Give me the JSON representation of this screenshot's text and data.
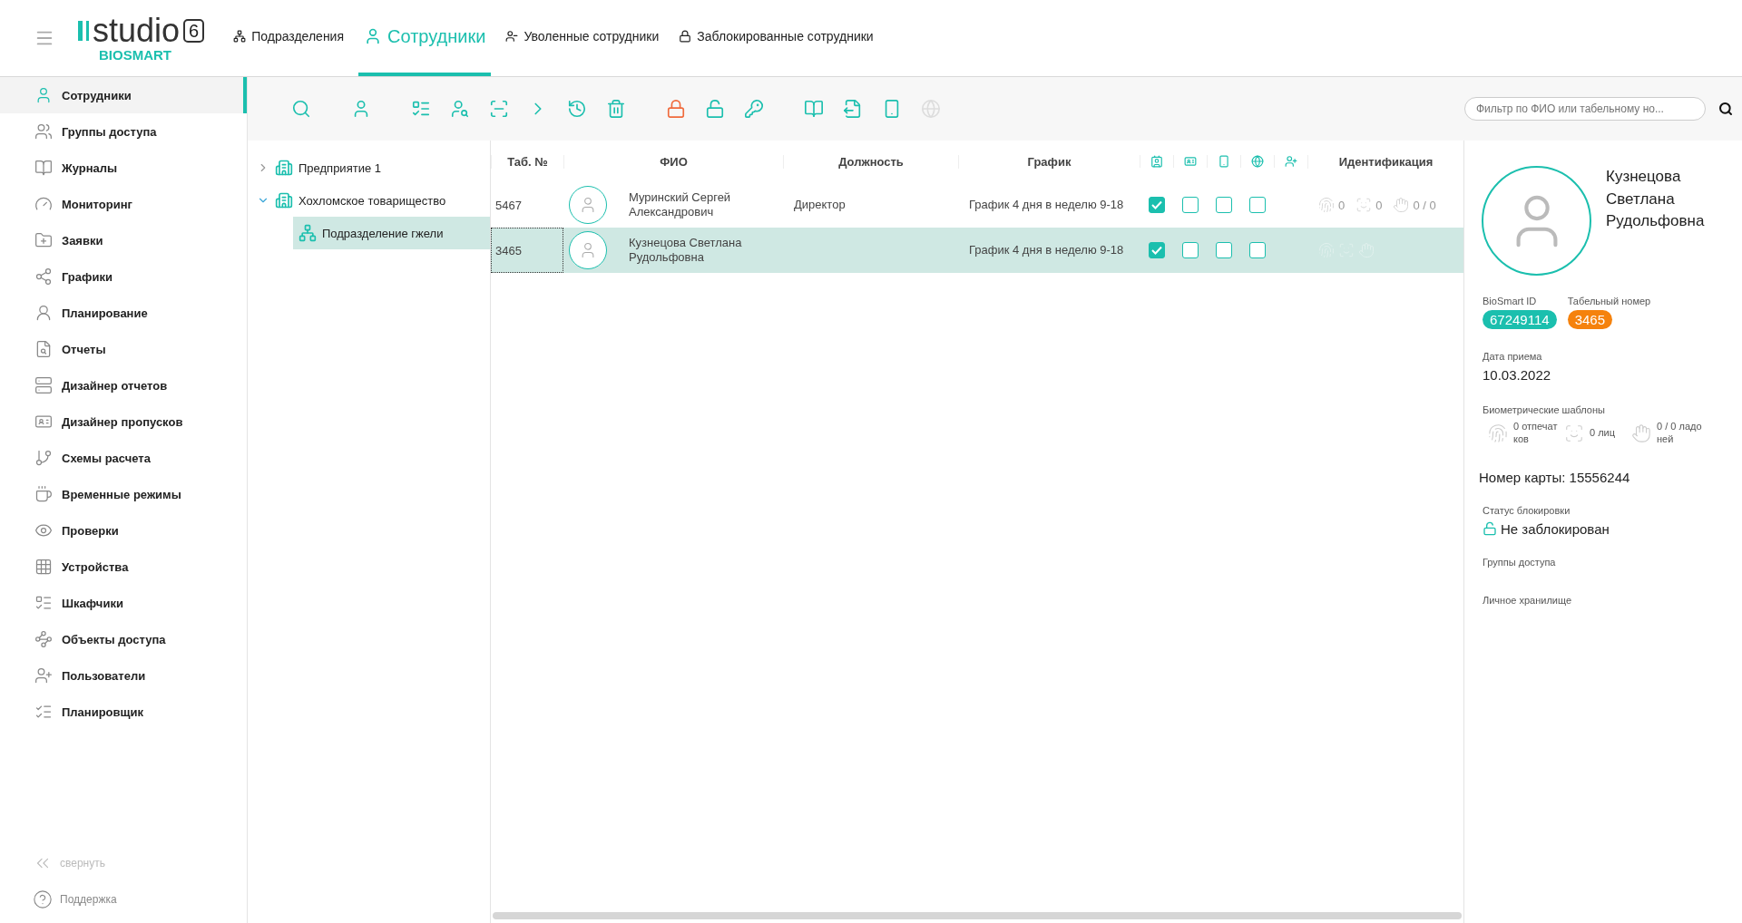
{
  "header": {
    "logo": {
      "word": "studio",
      "version": "6",
      "brand": "BIOSMART"
    },
    "tabs": [
      {
        "label": "Подразделения",
        "selected": false
      },
      {
        "label": "Сотрудники",
        "selected": true
      },
      {
        "label": "Уволенные сотрудники",
        "selected": false
      },
      {
        "label": "Заблокированные сотрудники",
        "selected": false
      }
    ]
  },
  "sidebar": {
    "items": [
      {
        "label": "Сотрудники",
        "selected": true
      },
      {
        "label": "Группы доступа",
        "selected": false
      },
      {
        "label": "Журналы",
        "selected": false
      },
      {
        "label": "Мониторинг",
        "selected": false
      },
      {
        "label": "Заявки",
        "selected": false
      },
      {
        "label": "Графики",
        "selected": false
      },
      {
        "label": "Планирование",
        "selected": false
      },
      {
        "label": "Отчеты",
        "selected": false
      },
      {
        "label": "Дизайнер отчетов",
        "selected": false
      },
      {
        "label": "Дизайнер пропусков",
        "selected": false
      },
      {
        "label": "Схемы расчета",
        "selected": false
      },
      {
        "label": "Временные режимы",
        "selected": false
      },
      {
        "label": "Проверки",
        "selected": false
      },
      {
        "label": "Устройства",
        "selected": false
      },
      {
        "label": "Шкафчики",
        "selected": false
      },
      {
        "label": "Объекты доступа",
        "selected": false
      },
      {
        "label": "Пользователи",
        "selected": false
      },
      {
        "label": "Планировщик",
        "selected": false
      }
    ],
    "collapse": "свернуть",
    "support": "Поддержка"
  },
  "toolbar": {
    "buttons": [
      {
        "kind": "normal",
        "disabled": false
      },
      {
        "kind": "normal",
        "disabled": false
      },
      {
        "kind": "normal",
        "disabled": false
      },
      {
        "kind": "normal",
        "disabled": false
      },
      {
        "kind": "normal",
        "disabled": false
      },
      {
        "kind": "normal",
        "disabled": false
      },
      {
        "kind": "normal",
        "disabled": false
      },
      {
        "kind": "normal",
        "disabled": false
      },
      {
        "kind": "warning",
        "disabled": false
      },
      {
        "kind": "normal",
        "disabled": false
      },
      {
        "kind": "normal",
        "disabled": false
      },
      {
        "kind": "normal",
        "disabled": false
      },
      {
        "kind": "normal",
        "disabled": false
      },
      {
        "kind": "normal",
        "disabled": false
      },
      {
        "kind": "normal",
        "disabled": true
      }
    ],
    "search": {
      "placeholder": "Фильтр по ФИО или табельному но..."
    }
  },
  "tree": [
    {
      "label": "Предприятие 1",
      "expanded": false,
      "selected": false
    },
    {
      "label": "Хохломское товарищество",
      "expanded": true,
      "selected": false,
      "children": [
        {
          "label": "Подразделение гжели",
          "selected": true
        }
      ]
    }
  ],
  "table": {
    "columns": [
      "Таб. №",
      "ФИО",
      "Должность",
      "График",
      "Идентификация"
    ],
    "rows": [
      {
        "tab": "5467",
        "name": "Муринский Сергей Александрович",
        "position": "Директор",
        "schedule": "График 4 дня в неделю 9-18",
        "flags": [
          true,
          false,
          false,
          false
        ],
        "fingerprints": "0",
        "faces": "0",
        "palms": "0 / 0",
        "selected": false
      },
      {
        "tab": "3465",
        "name": "Кузнецова Светлана Рудольфовна",
        "schedule": "График 4 дня в неделю 9-18",
        "flags": [
          true,
          false,
          false,
          false
        ],
        "selected": true
      }
    ]
  },
  "details": {
    "name": "Кузнецова Светлана Рудольфовна",
    "id_label": "BioSmart ID",
    "id": "67249114",
    "tab_label": "Табельный номер",
    "tab": "3465",
    "hire_label": "Дата приема",
    "hire_date": "10.03.2022",
    "bio_label": "Биометрические шаблоны",
    "fingerprints": "0 отпечатков",
    "faces": "0 лиц",
    "palms": "0 / 0 ладоней",
    "card": "Номер карты: 15556244",
    "lock_label": "Статус блокировки",
    "lock_status": "Не заблокирован",
    "groups_label": "Группы доступа",
    "storage_label": "Личное хранилище"
  }
}
